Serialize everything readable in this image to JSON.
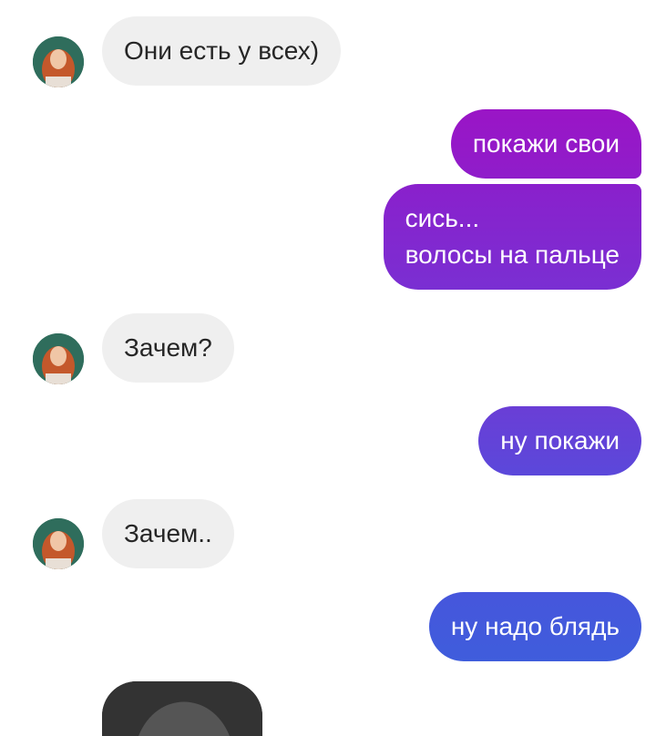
{
  "conversation": {
    "messages": [
      {
        "direction": "incoming",
        "text": "Они есть у всех)"
      },
      {
        "direction": "outgoing",
        "text": "покажи свои"
      },
      {
        "direction": "outgoing",
        "lines": [
          "сись...",
          "волосы на пальце"
        ]
      },
      {
        "direction": "incoming",
        "text": "Зачем?"
      },
      {
        "direction": "outgoing",
        "text": "ну покажи"
      },
      {
        "direction": "incoming",
        "text": "Зачем.."
      },
      {
        "direction": "outgoing",
        "text": "ну надо блядь"
      }
    ]
  },
  "colors": {
    "incoming_bubble": "#efefef",
    "incoming_text": "#262626",
    "outgoing_text": "#ffffff",
    "outgoing_gradient_top": "#9b14c8",
    "outgoing_gradient_bottom": "#3f5ddc",
    "background": "#ffffff"
  },
  "icons": {
    "contact_avatar": "avatar-photo"
  }
}
